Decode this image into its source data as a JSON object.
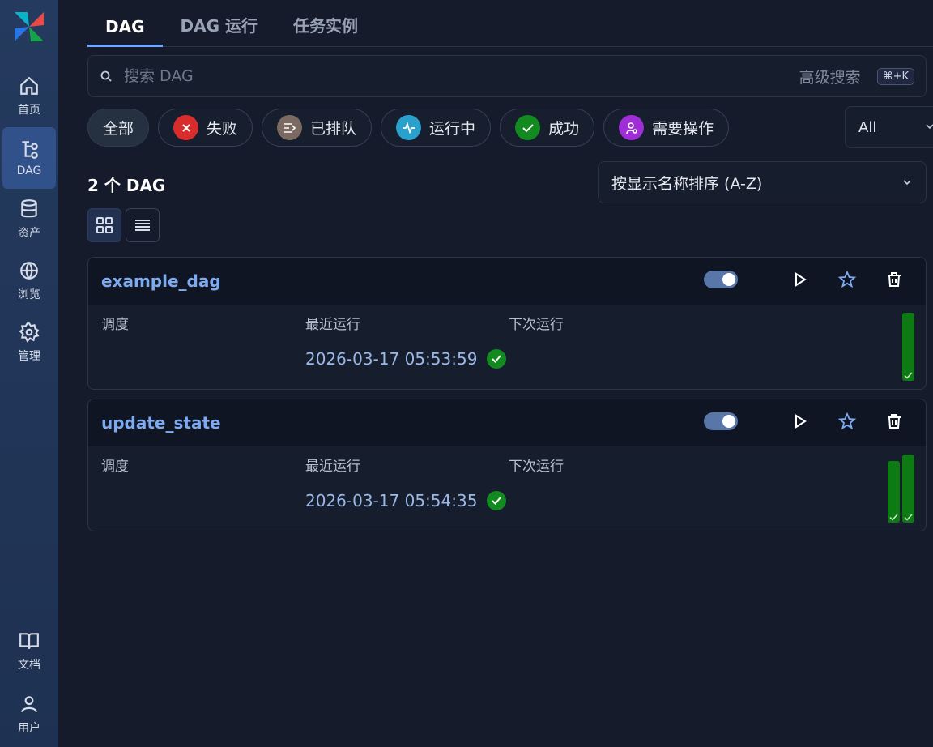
{
  "sidebar": {
    "items": [
      {
        "label": "首页",
        "icon": "home-icon"
      },
      {
        "label": "DAG",
        "icon": "dag-icon",
        "active": true
      },
      {
        "label": "资产",
        "icon": "database-icon"
      },
      {
        "label": "浏览",
        "icon": "globe-icon"
      },
      {
        "label": "管理",
        "icon": "gear-icon"
      }
    ],
    "bottom_items": [
      {
        "label": "文档",
        "icon": "book-icon"
      },
      {
        "label": "用户",
        "icon": "user-icon"
      }
    ]
  },
  "tabs": [
    {
      "label": "DAG",
      "active": true
    },
    {
      "label": "DAG 运行"
    },
    {
      "label": "任务实例"
    }
  ],
  "search": {
    "placeholder": "搜索 DAG",
    "advanced_label": "高级搜索",
    "shortcut": "⌘+K"
  },
  "filters": {
    "all_label": "全部",
    "failed_label": "失败",
    "queued_label": "已排队",
    "running_label": "运行中",
    "success_label": "成功",
    "needs_action_label": "需要操作",
    "select_value": "All"
  },
  "colors": {
    "failed": "#d92d2d",
    "queued": "#7a6a62",
    "running": "#2aa0cc",
    "success": "#138a1f",
    "needs_action": "#a02ed6",
    "accent": "#7eaaf0"
  },
  "list": {
    "count_label": "2 个 DAG",
    "sort_label": "按显示名称排序 (A-Z)"
  },
  "columns": {
    "schedule": "调度",
    "latest_run": "最近运行",
    "next_run": "下次运行"
  },
  "dags": [
    {
      "name": "example_dag",
      "latest_run": "2026-03-17 05:53:59",
      "enabled": true,
      "recent_runs": [
        "success"
      ]
    },
    {
      "name": "update_state",
      "latest_run": "2026-03-17 05:54:35",
      "enabled": true,
      "recent_runs": [
        "success",
        "success"
      ]
    }
  ]
}
